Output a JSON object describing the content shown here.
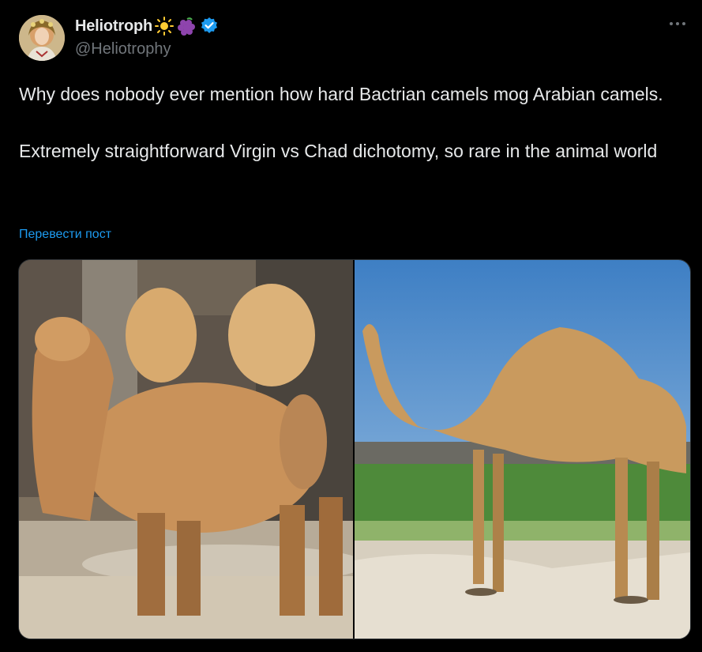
{
  "author": {
    "display_name": "Heliotroph",
    "handle": "@Heliotrophy",
    "emojis": [
      "sun-icon",
      "grapes-icon"
    ],
    "verified_badge": "verified-badge-icon"
  },
  "tweet": {
    "paragraphs": [
      "Why does nobody ever mention how hard Bactrian camels mog Arabian camels.",
      "Extremely straightforward Virgin vs Chad dichotomy, so rare in the animal world"
    ],
    "translate_label": "Перевести пост"
  },
  "media": {
    "photos": [
      {
        "subject": "bactrian-camel-photo"
      },
      {
        "subject": "arabian-camel-photo"
      }
    ]
  },
  "colors": {
    "background": "#000000",
    "text": "#e7e9ea",
    "secondary_text": "#71767b",
    "link": "#1d9bf0",
    "verified": "#1d9bf0"
  }
}
